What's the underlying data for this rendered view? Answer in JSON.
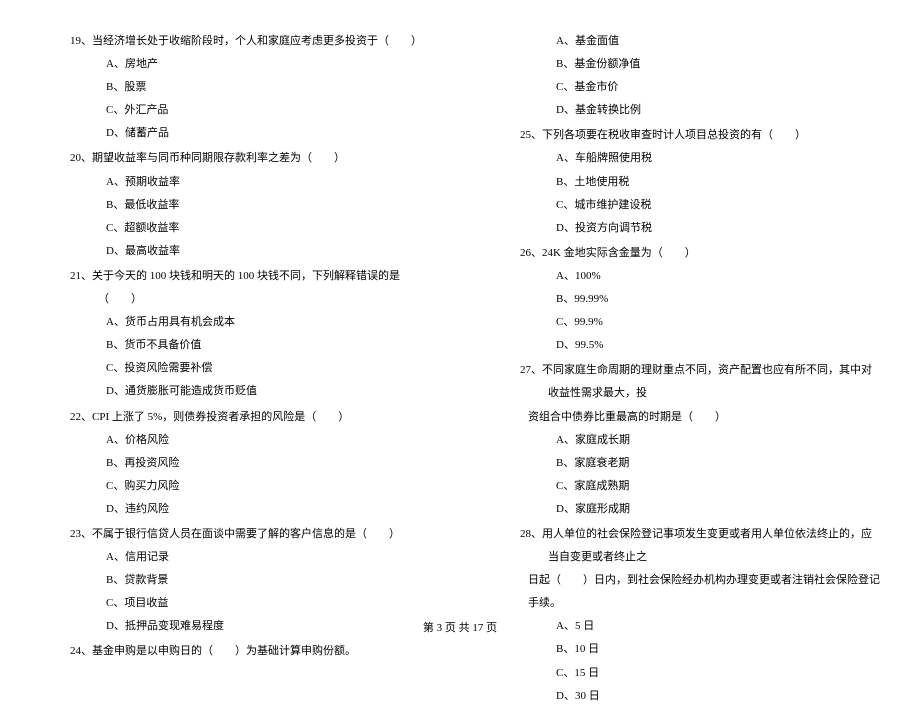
{
  "left": {
    "q19": {
      "text": "19、当经济增长处于收缩阶段时，个人和家庭应考虑更多投资于（　　）",
      "a": "A、房地产",
      "b": "B、股票",
      "c": "C、外汇产品",
      "d": "D、储蓄产品"
    },
    "q20": {
      "text": "20、期望收益率与同币种同期限存款利率之差为（　　）",
      "a": "A、预期收益率",
      "b": "B、最低收益率",
      "c": "C、超额收益率",
      "d": "D、最高收益率"
    },
    "q21": {
      "text": "21、关于今天的 100 块钱和明天的 100 块钱不同，下列解释错误的是（　　）",
      "a": "A、货币占用具有机会成本",
      "b": "B、货币不具备价值",
      "c": "C、投资风险需要补偿",
      "d": "D、通货膨胀可能造成货币贬值"
    },
    "q22": {
      "text": "22、CPI 上涨了 5%，则债券投资者承担的风险是（　　）",
      "a": "A、价格风险",
      "b": "B、再投资风险",
      "c": "C、购买力风险",
      "d": "D、违约风险"
    },
    "q23": {
      "text": "23、不属于银行信贷人员在面谈中需要了解的客户信息的是（　　）",
      "a": "A、信用记录",
      "b": "B、贷款背景",
      "c": "C、项目收益",
      "d": "D、抵押品变现难易程度"
    },
    "q24": {
      "text": "24、基金申购是以申购日的（　　）为基础计算申购份额。"
    }
  },
  "right": {
    "q24opts": {
      "a": "A、基金面值",
      "b": "B、基金份额净值",
      "c": "C、基金市价",
      "d": "D、基金转换比例"
    },
    "q25": {
      "text": "25、下列各项要在税收审查时计人项目总投资的有（　　）",
      "a": "A、车船牌照使用税",
      "b": "B、土地使用税",
      "c": "C、城市维护建设税",
      "d": "D、投资方向调节税"
    },
    "q26": {
      "text": "26、24K 金地实际含金量为（　　）",
      "a": "A、100%",
      "b": "B、99.99%",
      "c": "C、99.9%",
      "d": "D、99.5%"
    },
    "q27": {
      "text": "27、不同家庭生命周期的理财重点不同，资产配置也应有所不同，其中对收益性需求最大，投",
      "text2": "资组合中债券比重最高的时期是（　　）",
      "a": "A、家庭成长期",
      "b": "B、家庭衰老期",
      "c": "C、家庭成熟期",
      "d": "D、家庭形成期"
    },
    "q28": {
      "text": "28、用人单位的社会保险登记事项发生变更或者用人单位依法终止的，应当自变更或者终止之",
      "text2": "日起（　　）日内，到社会保险经办机构办理变更或者注销社会保险登记手续。",
      "a": "A、5 日",
      "b": "B、10 日",
      "c": "C、15 日",
      "d": "D、30 日"
    }
  },
  "footer": "第 3 页 共 17 页"
}
